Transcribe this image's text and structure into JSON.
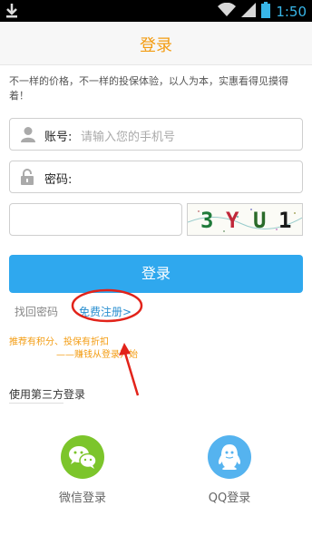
{
  "status_bar": {
    "time": "1:50"
  },
  "header": {
    "title": "登录"
  },
  "slogan": "不一样的价格，不一样的投保体验，以人为本，实惠看得见摸得着！",
  "account": {
    "label": "账号:",
    "placeholder": "请输入您的手机号"
  },
  "password": {
    "label": "密码:"
  },
  "captcha": {
    "text": [
      "3",
      "Y",
      "U",
      "1"
    ]
  },
  "login_button": "登录",
  "links": {
    "forgot": "找回密码",
    "register": "免费注册>"
  },
  "promo": {
    "line1": "推荐有积分、投保有折扣",
    "line2": "——赚钱从登录开始"
  },
  "third_party": {
    "title": "使用第三方登录",
    "wechat_label": "微信登录",
    "qq_label": "QQ登录"
  },
  "colors": {
    "accent": "#f39c12",
    "primary": "#2fa8ee",
    "wechat": "#7cc52b",
    "qq": "#55b3ef",
    "annotation": "#e2231a"
  }
}
